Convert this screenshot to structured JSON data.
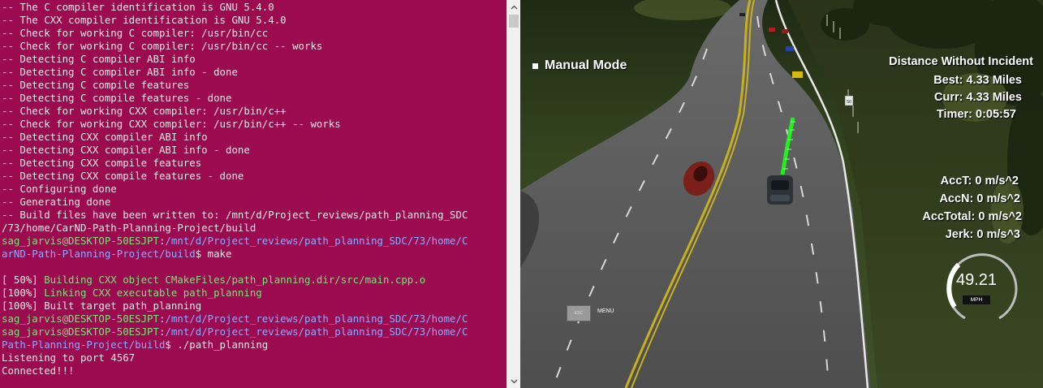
{
  "terminal": {
    "background": "#9c0b4f",
    "lines": [
      [
        {
          "t": "-- The C compiler identification is GNU 5.4.0",
          "c": "white"
        }
      ],
      [
        {
          "t": "-- The CXX compiler identification is GNU 5.4.0",
          "c": "white"
        }
      ],
      [
        {
          "t": "-- Check for working C compiler: /usr/bin/cc",
          "c": "white"
        }
      ],
      [
        {
          "t": "-- Check for working C compiler: /usr/bin/cc -- works",
          "c": "white"
        }
      ],
      [
        {
          "t": "-- Detecting C compiler ABI info",
          "c": "white"
        }
      ],
      [
        {
          "t": "-- Detecting C compiler ABI info - done",
          "c": "white"
        }
      ],
      [
        {
          "t": "-- Detecting C compile features",
          "c": "white"
        }
      ],
      [
        {
          "t": "-- Detecting C compile features - done",
          "c": "white"
        }
      ],
      [
        {
          "t": "-- Check for working CXX compiler: /usr/bin/c++",
          "c": "white"
        }
      ],
      [
        {
          "t": "-- Check for working CXX compiler: /usr/bin/c++ -- works",
          "c": "white"
        }
      ],
      [
        {
          "t": "-- Detecting CXX compiler ABI info",
          "c": "white"
        }
      ],
      [
        {
          "t": "-- Detecting CXX compiler ABI info - done",
          "c": "white"
        }
      ],
      [
        {
          "t": "-- Detecting CXX compile features",
          "c": "white"
        }
      ],
      [
        {
          "t": "-- Detecting CXX compile features - done",
          "c": "white"
        }
      ],
      [
        {
          "t": "-- Configuring done",
          "c": "white"
        }
      ],
      [
        {
          "t": "-- Generating done",
          "c": "white"
        }
      ],
      [
        {
          "t": "-- Build files have been written to: /mnt/d/Project_reviews/path_planning_SDC",
          "c": "white"
        }
      ],
      [
        {
          "t": "/73/home/CarND-Path-Planning-Project/build",
          "c": "white"
        }
      ],
      [
        {
          "t": "sag_jarvis@DESKTOP-50ESJPT",
          "c": "user"
        },
        {
          "t": ":",
          "c": "white"
        },
        {
          "t": "/mnt/d/Project_reviews/path_planning_SDC/73/home/C",
          "c": "path"
        }
      ],
      [
        {
          "t": "arND-Path-Planning-Project/build",
          "c": "path"
        },
        {
          "t": "$ make",
          "c": "white"
        }
      ],
      [
        {
          "t": "",
          "c": "white"
        }
      ],
      [
        {
          "t": "[ 50%] ",
          "c": "white"
        },
        {
          "t": "Building CXX object CMakeFiles/path_planning.dir/src/main.cpp.o",
          "c": "green"
        }
      ],
      [
        {
          "t": "[100%] ",
          "c": "white"
        },
        {
          "t": "Linking CXX executable path_planning",
          "c": "green"
        }
      ],
      [
        {
          "t": "[100%] Built target path_planning",
          "c": "white"
        }
      ],
      [
        {
          "t": "sag_jarvis@DESKTOP-50ESJPT",
          "c": "user"
        },
        {
          "t": ":",
          "c": "white"
        },
        {
          "t": "/mnt/d/Project_reviews/path_planning_SDC/73/home/C",
          "c": "path"
        }
      ],
      [
        {
          "t": "sag_jarvis@DESKTOP-50ESJPT",
          "c": "user"
        },
        {
          "t": ":",
          "c": "white"
        },
        {
          "t": "/mnt/d/Project_reviews/path_planning_SDC/73/home/C",
          "c": "path"
        }
      ],
      [
        {
          "t": "Path-Planning-Project/build",
          "c": "path"
        },
        {
          "t": "$ ./path_planning",
          "c": "white"
        }
      ],
      [
        {
          "t": "Listening to port 4567",
          "c": "white"
        }
      ],
      [
        {
          "t": "Connected!!!",
          "c": "white"
        }
      ]
    ]
  },
  "scrollbar": {
    "up_icon": "chevron-up-icon",
    "down_icon": "chevron-down-icon"
  },
  "simulator": {
    "manual_mode": "Manual Mode",
    "distance_title": "Distance Without Incident",
    "best": "Best: 4.33 Miles",
    "curr": "Curr: 4.33 Miles",
    "timer": "Timer: 0:05:57",
    "acc_t": "AccT: 0 m/s^2",
    "acc_n": "AccN: 0 m/s^2",
    "acc_total": "AccTotal: 0 m/s^2",
    "jerk": "Jerk: 0 m/s^3",
    "speed": "49.21",
    "speed_unit": "MPH",
    "esc_label": "ESC",
    "menu_label": "MENU",
    "speed_limit_sign": "50",
    "colors": {
      "road": "#4f4f4f",
      "grass": "#3b4a27",
      "trajectory": "#22ee22",
      "center_line": "#c8b020",
      "ego_car": "#2c3238",
      "other_car": "#7a1f1a"
    }
  }
}
